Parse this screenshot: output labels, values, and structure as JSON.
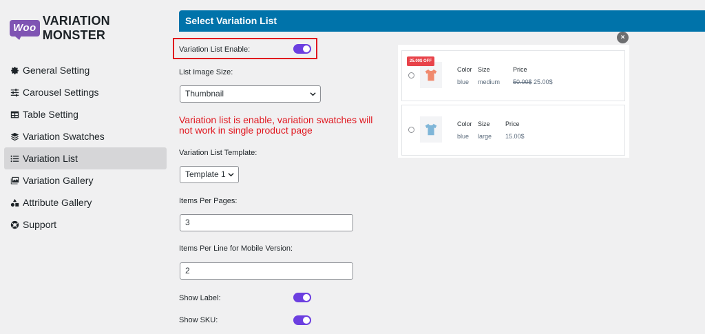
{
  "logo": {
    "badge": "Woo",
    "name": "VARIATION MONSTER",
    "brand_color": "#7f54b3"
  },
  "sidebar": {
    "items": [
      {
        "label": "General Setting",
        "icon": "gear-icon",
        "active": false
      },
      {
        "label": "Carousel Settings",
        "icon": "sliders-icon",
        "active": false
      },
      {
        "label": "Table Setting",
        "icon": "table-icon",
        "active": false
      },
      {
        "label": "Variation Swatches",
        "icon": "layers-icon",
        "active": false
      },
      {
        "label": "Variation List",
        "icon": "list-icon",
        "active": true
      },
      {
        "label": "Variation Gallery",
        "icon": "images-icon",
        "active": false
      },
      {
        "label": "Attribute Gallery",
        "icon": "shapes-icon",
        "active": false
      },
      {
        "label": "Support",
        "icon": "lifebuoy-icon",
        "active": false
      }
    ]
  },
  "panel": {
    "title": "Select Variation List",
    "header_color": "#0073aa",
    "enable": {
      "label": "Variation List Enable:",
      "value": true
    },
    "image_size": {
      "label": "List Image Size:",
      "value": "Thumbnail"
    },
    "warning": "Variation list is enable, variation swatches will not work in single product page",
    "template": {
      "label": "Variation List Template:",
      "value": "Template 1"
    },
    "items_per_page": {
      "label": "Items Per Pages:",
      "value": "3"
    },
    "items_per_line_mobile": {
      "label": "Items Per Line for Mobile Version:",
      "value": "2"
    },
    "show_label": {
      "label": "Show Label:",
      "value": true
    },
    "show_sku": {
      "label": "Show SKU:",
      "value": true
    },
    "toggle_color": "#6c3fe0",
    "highlight_color": "#e0161e"
  },
  "preview": {
    "close_label": "×",
    "headers": {
      "color": "Color",
      "size": "Size",
      "price": "Price"
    },
    "rows": [
      {
        "badge": "25.00$ OFF",
        "color": "blue",
        "size": "medium",
        "old_price": "50.00$",
        "price": "25.00$",
        "shirt_color": "#f08a6e"
      },
      {
        "badge": "",
        "color": "blue",
        "size": "large",
        "old_price": "",
        "price": "15.00$",
        "shirt_color": "#7fb6d8"
      }
    ]
  }
}
